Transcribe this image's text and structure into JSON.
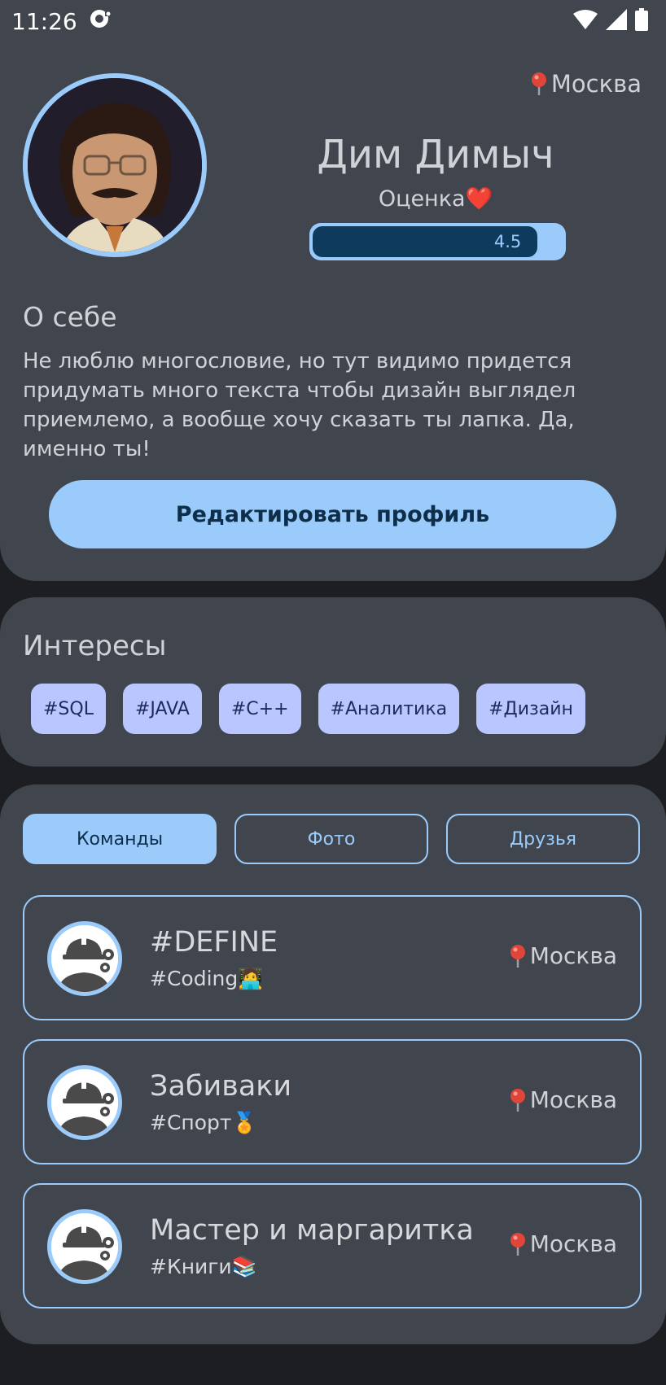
{
  "status_bar": {
    "time": "11:26",
    "icons": [
      "notification-icon",
      "wifi-icon",
      "signal-icon",
      "battery-icon"
    ]
  },
  "profile": {
    "location": "Москва",
    "name": "Дим Димыч",
    "rating_label": "Оценка❤️",
    "rating_value": "4.5",
    "rating_fraction": 0.9,
    "about_title": "О себе",
    "about_text": "Не люблю многословие, но тут видимо придется придумать много текста чтобы дизайн выглядел приемлемо, а вообще хочу сказать ты лапка. Да, именно ты!",
    "edit_button_label": "Редактировать профиль"
  },
  "interests": {
    "title": "Интересы",
    "tags": [
      "#SQL",
      "#JAVA",
      "#C++",
      "#Аналитика",
      "#Дизайн"
    ]
  },
  "tabs": {
    "items": [
      "Команды",
      "Фото",
      "Друзья"
    ],
    "active": "Команды"
  },
  "teams": [
    {
      "name": "#DEFINE",
      "tag": "#Coding🧑‍💻",
      "location": "Москва"
    },
    {
      "name": "Забиваки",
      "tag": "#Спорт🏅",
      "location": "Москва"
    },
    {
      "name": "Мастер и маргаритка",
      "tag": "#Книги📚",
      "location": "Москва"
    }
  ],
  "colors": {
    "card_bg": "#41464e",
    "page_bg": "#1c1e21",
    "accent": "#9acbfb",
    "tag_bg": "#b9c6ff",
    "rating_fill": "#0e3a5e"
  }
}
